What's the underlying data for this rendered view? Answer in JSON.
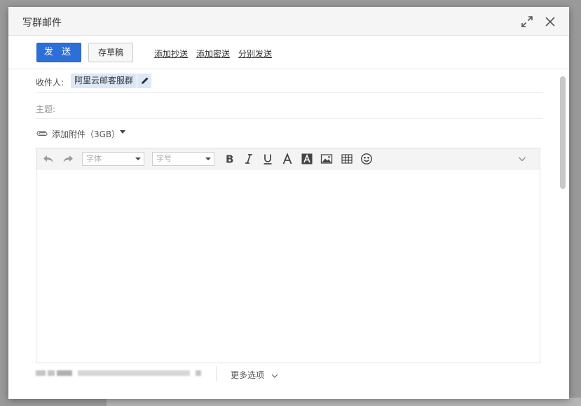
{
  "dialog": {
    "title": "写群邮件"
  },
  "toolbar": {
    "send_label": "发 送",
    "draft_label": "存草稿",
    "add_cc": "添加抄送",
    "add_bcc": "添加密送",
    "separate_send": "分别发送"
  },
  "fields": {
    "recipient_label": "收件人:",
    "recipient_value": "阿里云邮客服群",
    "subject_label": "主题:"
  },
  "attachment": {
    "label": "添加附件（3GB）"
  },
  "editor": {
    "font_placeholder": "字体",
    "size_placeholder": "字号",
    "icons": [
      "undo-icon",
      "redo-icon",
      "bold-icon",
      "italic-icon",
      "underline-icon",
      "font-color-icon",
      "background-color-icon",
      "image-icon",
      "table-icon",
      "emoji-icon",
      "expand-toolbar-icon"
    ]
  },
  "footer": {
    "more_options": "更多选项"
  },
  "colors": {
    "send_button": "#2d6fd8",
    "recipient_chip": "#dde8f7"
  }
}
